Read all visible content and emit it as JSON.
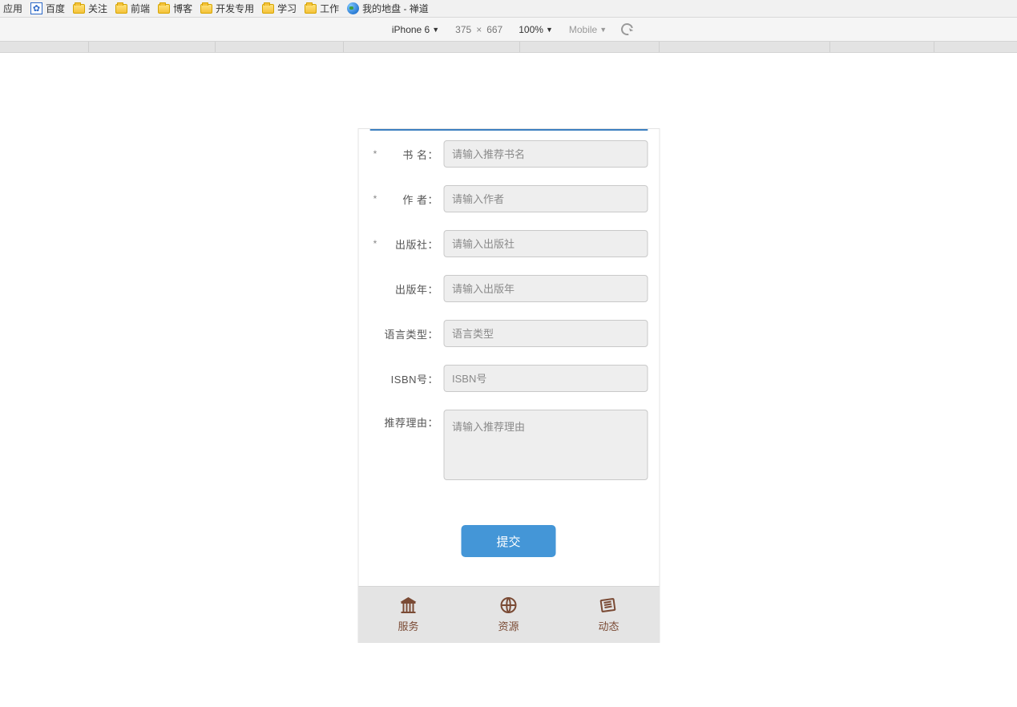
{
  "bookmarks": {
    "app_label": "应用",
    "items": [
      {
        "type": "baidu",
        "label": "百度"
      },
      {
        "type": "folder",
        "label": "关注"
      },
      {
        "type": "folder",
        "label": "前端"
      },
      {
        "type": "folder",
        "label": "博客"
      },
      {
        "type": "folder",
        "label": "开发专用"
      },
      {
        "type": "folder",
        "label": "学习"
      },
      {
        "type": "folder",
        "label": "工作"
      },
      {
        "type": "globe",
        "label": "我的地盘 - 禅道"
      }
    ]
  },
  "device_toolbar": {
    "device": "iPhone 6",
    "width": "375",
    "height": "667",
    "sep": "×",
    "zoom": "100%",
    "mode": "Mobile"
  },
  "form": {
    "required_mark": "*",
    "fields": {
      "book_name": {
        "label": "书 名：",
        "placeholder": "请输入推荐书名",
        "required": true
      },
      "author": {
        "label": "作 者：",
        "placeholder": "请输入作者",
        "required": true
      },
      "publisher": {
        "label": "出版社：",
        "placeholder": "请输入出版社",
        "required": true
      },
      "pub_year": {
        "label": "出版年：",
        "placeholder": "请输入出版年",
        "required": false
      },
      "lang_type": {
        "label": "语言类型：",
        "placeholder": "语言类型",
        "required": false
      },
      "isbn": {
        "label": "ISBN号：",
        "placeholder": "ISBN号",
        "required": false
      },
      "reason": {
        "label": "推荐理由：",
        "placeholder": "请输入推荐理由",
        "required": false
      }
    },
    "submit_label": "提交"
  },
  "bottom_nav": {
    "items": [
      {
        "label": "服务",
        "icon": "building-icon"
      },
      {
        "label": "资源",
        "icon": "globe-icon"
      },
      {
        "label": "动态",
        "icon": "news-icon"
      }
    ]
  }
}
